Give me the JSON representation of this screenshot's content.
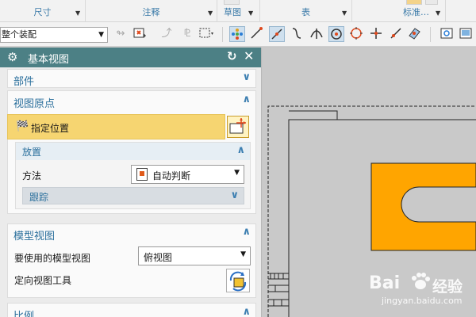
{
  "ribbon": {
    "groups": [
      {
        "label": "尺寸"
      },
      {
        "label": "注释"
      },
      {
        "label": "草图"
      },
      {
        "label": "表"
      },
      {
        "label": "标准…"
      }
    ]
  },
  "toolbar": {
    "filter_select_value": "整个装配",
    "icons": [
      "snap-disabled-icon",
      "selection-filter-icon",
      "link-disabled-icon",
      "tree-disabled-icon",
      "rectangle-select-icon",
      "snap-point-icon",
      "end-point-icon",
      "mid-point-icon",
      "curve-point-icon",
      "intersection-icon",
      "center-point-icon",
      "quadrant-point-icon",
      "crosshair-icon",
      "on-curve-icon",
      "surface-point-icon",
      "view-icon",
      "image-icon"
    ]
  },
  "panel": {
    "title": "基本视图",
    "sections": {
      "part": {
        "title": "部件"
      },
      "view_origin": {
        "title": "视图原点",
        "specify_location": "指定位置",
        "placement": {
          "title": "放置",
          "method_label": "方法",
          "method_value": "自动判断",
          "tracking": "跟踪"
        }
      },
      "model_view": {
        "title": "模型视图",
        "model_view_label": "要使用的模型视图",
        "model_view_value": "俯视图",
        "orient_tool_label": "定向视图工具"
      },
      "scale": {
        "title": "比例"
      }
    }
  },
  "watermark": {
    "logo": "Bai",
    "name": "经验",
    "url": "jingyan.baidu.com"
  },
  "colors": {
    "panel_header": "#4c8085",
    "highlight_row": "#f6d571",
    "section_title": "#2a6f9c",
    "part_fill": "#ffa500",
    "canvas_bg": "#c9c9c9"
  }
}
